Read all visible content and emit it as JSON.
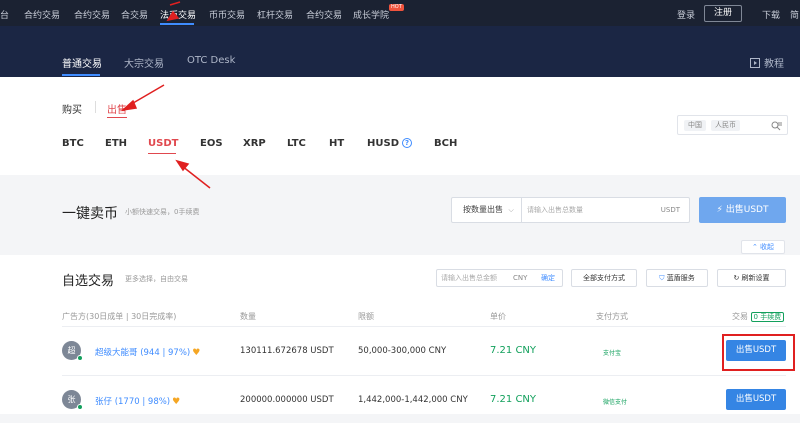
{
  "topnav": {
    "items": [
      "合约交易",
      "合约交易",
      "合交易",
      "法币交易",
      "币币交易",
      "杠杆交易",
      "合约交易",
      "成长学院"
    ],
    "partial_left": "台",
    "hot_badge": "HOT",
    "login": "登录",
    "register": "注册",
    "download": "下载",
    "partial_right": "简"
  },
  "subnav": {
    "tabs": [
      "普通交易",
      "大宗交易",
      "OTC Desk"
    ],
    "tutorial": "教程"
  },
  "filter": {
    "buy": "购买",
    "sell": "出售",
    "coins": [
      "BTC",
      "ETH",
      "USDT",
      "EOS",
      "XRP",
      "LTC",
      "HT",
      "HUSD",
      "BCH"
    ],
    "region": "中国",
    "currency": "人民币"
  },
  "quick": {
    "title": "一键卖币",
    "subtitle": "小额快速交易，0手续费",
    "select_label": "按数量出售",
    "placeholder": "请输入出售总数量",
    "unit": "USDT",
    "button": "出售USDT",
    "collapse": "收起"
  },
  "list": {
    "title": "自选交易",
    "subtitle": "更多选择，自由交易",
    "amount_placeholder": "请输入出售总金额",
    "amount_unit": "CNY",
    "confirm": "确定",
    "all_payment": "全部支付方式",
    "blue_shield": "蓝盾服务",
    "refresh": "刷新设置",
    "headers": {
      "advertiser": "广告方(30日成单 | 30日完成率)",
      "quantity": "数量",
      "limit": "限额",
      "price": "单价",
      "payment": "支付方式",
      "trade": "交易",
      "zero_fee": "0 手续费"
    },
    "rows": [
      {
        "avatar": "超",
        "merchant": "超级大能哥 (944 | 97%)",
        "quantity": "130111.672678 USDT",
        "limit": "50,000-300,000 CNY",
        "price": "7.21 CNY",
        "payment": "支付宝",
        "action": "出售USDT"
      },
      {
        "avatar": "张",
        "merchant": "张仔 (1770 | 98%)",
        "quantity": "200000.000000 USDT",
        "limit": "1,442,000-1,442,000 CNY",
        "price": "7.21 CNY",
        "payment": "微信支付",
        "action": "出售USDT"
      }
    ]
  },
  "colors": {
    "nav_bg": "#1b2232",
    "subnav_bg": "#1b2644",
    "accent_blue": "#3585e4",
    "sell_red": "#e0484e",
    "price_green": "#12a05c",
    "annotation_red": "#e02020"
  }
}
